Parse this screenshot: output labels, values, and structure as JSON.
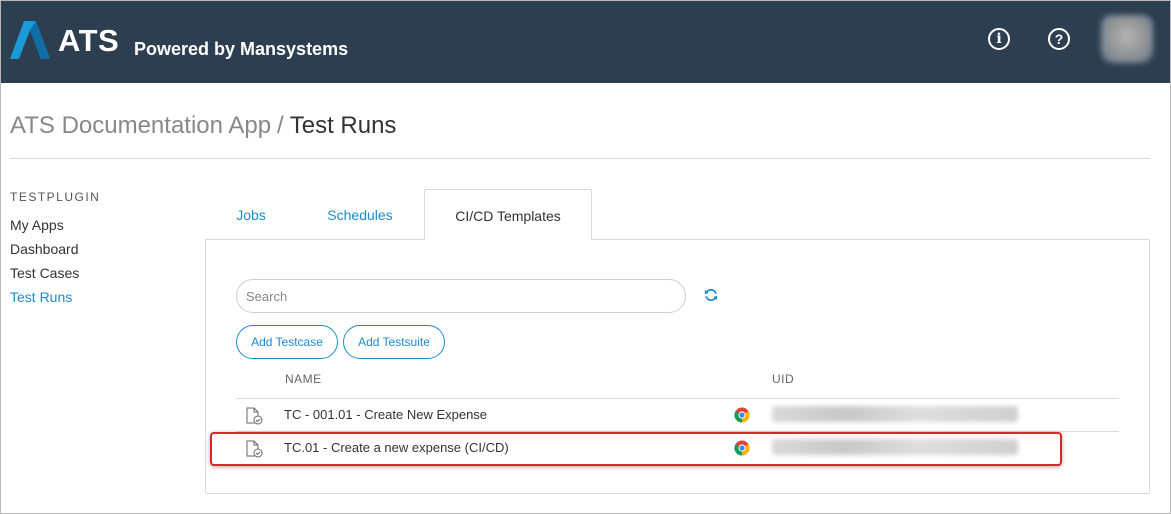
{
  "header": {
    "brand": "ATS",
    "powered_by": "Powered by Mansystems",
    "info_icon": "i",
    "help_icon": "?",
    "background": "#2d3e50",
    "logo_color": "#1a9ad9"
  },
  "breadcrumb": {
    "app": "ATS Documentation App",
    "separator": "/",
    "page": "Test Runs"
  },
  "sidebar": {
    "heading": "TESTPLUGIN",
    "items": [
      {
        "label": "My Apps"
      },
      {
        "label": "Dashboard"
      },
      {
        "label": "Test Cases"
      },
      {
        "label": "Test Runs",
        "active": true
      }
    ]
  },
  "tabs": [
    {
      "label": "Jobs"
    },
    {
      "label": "Schedules"
    },
    {
      "label": "CI/CD Templates",
      "active": true
    }
  ],
  "search": {
    "placeholder": "Search",
    "value": ""
  },
  "buttons": {
    "add_testcase": "Add Testcase",
    "add_testsuite": "Add Testsuite"
  },
  "table": {
    "columns": {
      "name": "NAME",
      "uid": "UID"
    },
    "rows": [
      {
        "icon": "testcase-document-icon",
        "name": "TC - 001.01 - Create New Expense",
        "browser": "chrome-icon"
      },
      {
        "icon": "testcase-document-icon",
        "name": "TC.01 - Create a new expense (CI/CD)",
        "browser": "chrome-icon",
        "highlighted": true
      }
    ]
  },
  "colors": {
    "accent": "#1a8ccc",
    "highlight": "#d9262a"
  }
}
